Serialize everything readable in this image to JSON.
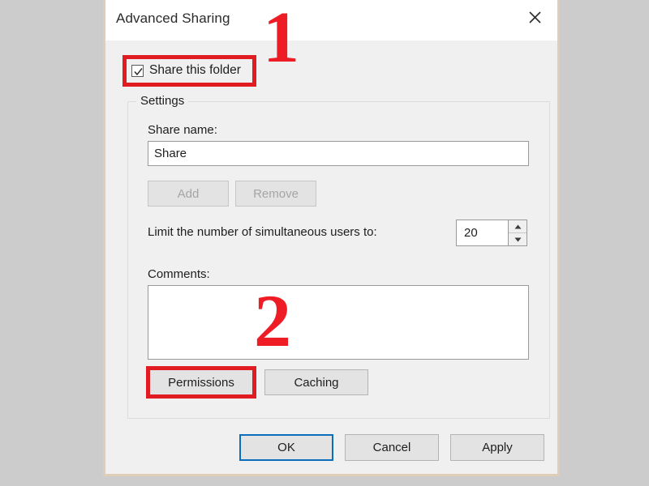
{
  "window": {
    "title": "Advanced Sharing",
    "close_icon": "close-x-icon"
  },
  "share_folder": {
    "label": "Share this folder",
    "checked": true,
    "check_icon": "checkmark-icon"
  },
  "settings": {
    "legend": "Settings",
    "share_name": {
      "label": "Share name:",
      "value": "Share",
      "placeholder": ""
    },
    "add_button": "Add",
    "remove_button": "Remove",
    "limit": {
      "label": "Limit the number of simultaneous users to:",
      "value": "20",
      "up_icon": "spinner-up-arrow-icon",
      "down_icon": "spinner-down-arrow-icon"
    },
    "comments": {
      "label": "Comments:",
      "value": "",
      "placeholder": ""
    },
    "permissions_button": "Permissions",
    "caching_button": "Caching"
  },
  "footer": {
    "ok_button": "OK",
    "cancel_button": "Cancel",
    "apply_button": "Apply"
  },
  "annotations": {
    "step_one": "1",
    "step_two": "2",
    "highlight_color": "#e01b22",
    "number_color": "#ee1c24"
  },
  "colors": {
    "desktop_background": "#cccccc",
    "dialog_background": "#f0f0f0",
    "titlebar_background": "#ffffff",
    "dialog_border": "#dfcdb8",
    "focus_border": "#0a6ebd"
  }
}
